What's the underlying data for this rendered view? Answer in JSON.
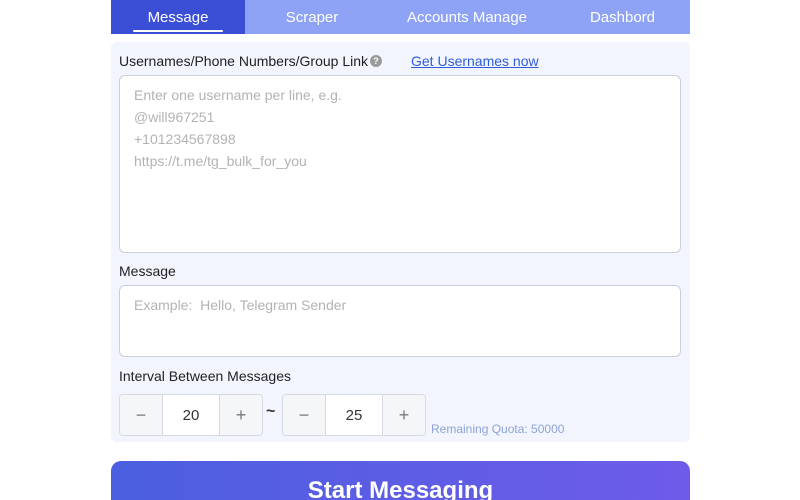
{
  "tabs": [
    {
      "label": "Message",
      "active": true
    },
    {
      "label": "Scraper",
      "active": false
    },
    {
      "label": "Accounts Manage",
      "active": false
    },
    {
      "label": "Dashbord",
      "active": false
    }
  ],
  "usernames": {
    "label": "Usernames/Phone Numbers/Group Link",
    "help_icon": "?",
    "link": "Get Usernames now",
    "placeholder": "Enter one username per line, e.g.\n@will967251\n+101234567898\nhttps://t.me/tg_bulk_for_you",
    "value": ""
  },
  "message": {
    "label": "Message",
    "placeholder": "Example:  Hello, Telegram Sender",
    "value": ""
  },
  "interval": {
    "label": "Interval Between Messages",
    "min_value": "20",
    "max_value": "25",
    "separator": "~",
    "decrement": "−",
    "increment": "+"
  },
  "quota": {
    "text": "Remaining Quota: 50000"
  },
  "start_button": {
    "label": "Start Messaging"
  },
  "colors": {
    "tab_active": "#3a4fd6",
    "tab_bar": "#8ea3f5",
    "link": "#2f5cd8",
    "button_start": "#4b5fe0",
    "button_end": "#6e5bea"
  }
}
